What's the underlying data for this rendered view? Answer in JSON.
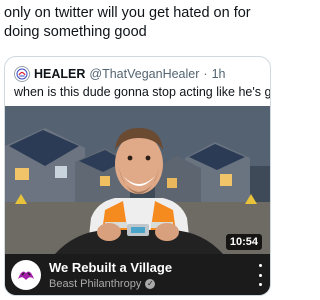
{
  "post": {
    "text": "only on twitter will you get hated on for doing something good"
  },
  "quote": {
    "display_name": "HEALER",
    "handle": "@ThatVeganHealer",
    "separator": "·",
    "time": "1h",
    "text": "when is this dude gonna stop acting like he's god",
    "avatar_icon": "circular-logo-icon"
  },
  "video": {
    "duration": "10:54",
    "title": "We Rebuilt a Village",
    "channel": "Beast Philanthropy",
    "verified_icon": "check-badge-icon",
    "menu_icon": "kebab-menu-icon",
    "colors": {
      "vest": "#f58a1f",
      "reflective_stripe": "#d9dbd6",
      "bar_background": "#1b1b1b"
    }
  }
}
